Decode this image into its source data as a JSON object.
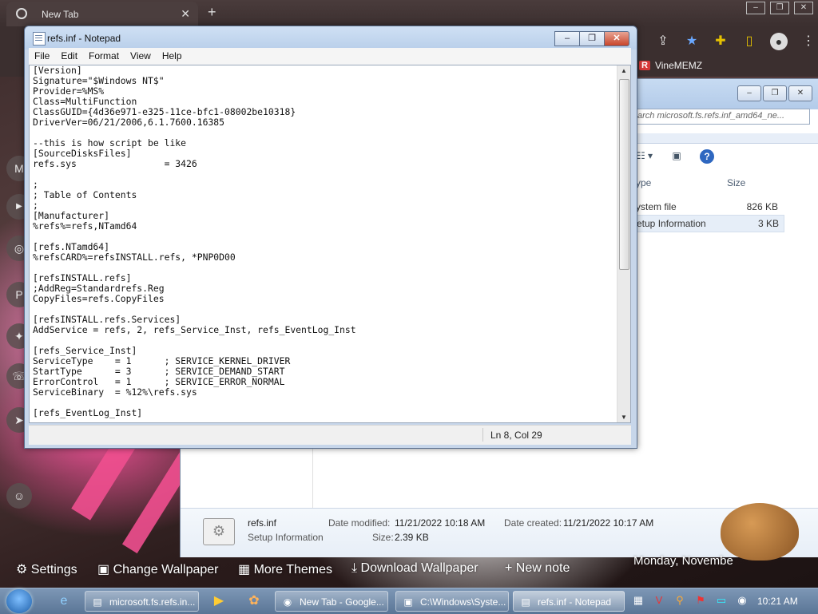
{
  "chrome": {
    "tab_title": "New Tab",
    "bookmark_vinememz": "VineMEMZ",
    "bookmark_vinememz_badge": "R"
  },
  "explorer": {
    "search_placeholder": "arch microsoft.fs.refs.inf_amd64_ne...",
    "columns": {
      "type": "ype",
      "size": "Size"
    },
    "rows": [
      {
        "type": "ystem file",
        "size": "826 KB"
      },
      {
        "type": "etup Information",
        "size": "3 KB"
      }
    ],
    "details": {
      "name": "refs.inf",
      "kind": "Setup Information",
      "date_modified_label": "Date modified:",
      "date_modified": "11/21/2022 10:18 AM",
      "date_created_label": "Date created:",
      "date_created": "11/21/2022 10:17 AM",
      "size_label": "Size:",
      "size": "2.39 KB"
    }
  },
  "notepad": {
    "title": "refs.inf - Notepad",
    "menu": [
      "File",
      "Edit",
      "Format",
      "View",
      "Help"
    ],
    "content": "[Version]\nSignature=\"$Windows NT$\"\nProvider=%MS%\nClass=MultiFunction\nClassGUID={4d36e971-e325-11ce-bfc1-08002be10318}\nDriverVer=06/21/2006,6.1.7600.16385\n\n--this is how script be like\n[SourceDisksFiles]\nrefs.sys                = 3426\n\n;\n; Table of Contents\n;\n[Manufacturer]\n%refs%=refs,NTamd64\n\n[refs.NTamd64]\n%refsCARD%=refsINSTALL.refs, *PNP0D00\n\n[refsINSTALL.refs]\n;AddReg=Standardrefs.Reg\nCopyFiles=refs.CopyFiles\n\n[refsINSTALL.refs.Services]\nAddService = refs, 2, refs_Service_Inst, refs_EventLog_Inst\n\n[refs_Service_Inst]\nServiceType    = 1      ; SERVICE_KERNEL_DRIVER\nStartType      = 3      ; SERVICE_DEMAND_START\nErrorControl   = 1      ; SERVICE_ERROR_NORMAL\nServiceBinary  = %12%\\refs.sys\n\n[refs_EventLog_Inst]",
    "status_position": "Ln 8, Col 29"
  },
  "wallpaper_bar": {
    "settings": "Settings",
    "change_wallpaper": "Change Wallpaper",
    "more_themes": "More Themes",
    "download_wallpaper": "Download Wallpaper",
    "new_note": "+ New note",
    "date_text": "Monday, Novembe"
  },
  "taskbar": {
    "items": [
      "microsoft.fs.refs.in...",
      "New Tab - Google...",
      "C:\\Windows\\Syste...",
      "refs.inf - Notepad"
    ],
    "clock": "10:21 AM"
  }
}
